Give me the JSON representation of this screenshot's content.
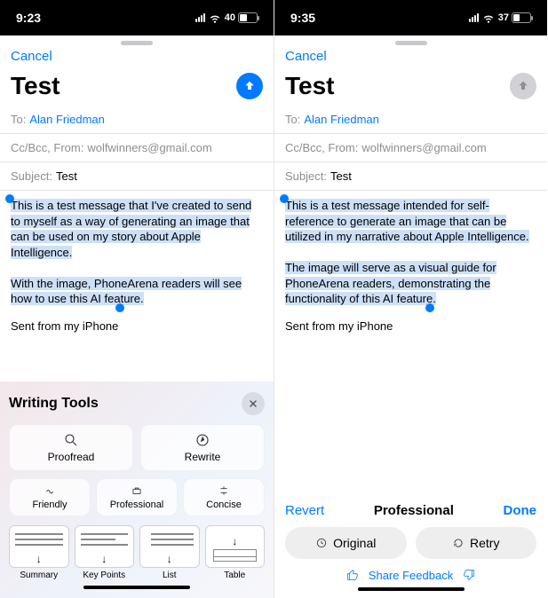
{
  "left": {
    "status": {
      "time": "9:23",
      "battery_pct": 40
    },
    "nav": {
      "cancel": "Cancel"
    },
    "compose": {
      "title": "Test",
      "to_label": "To:",
      "to_name": "Alan Friedman",
      "cc_from_label": "Cc/Bcc, From:",
      "from_email": "wolfwinners@gmail.com",
      "subject_label": "Subject:",
      "subject_value": "Test",
      "paragraph1": "This is a test message that I've created to send to myself as a way of generating an image that can be used on my story about Apple Intelligence.",
      "paragraph2": "With the image, PhoneArena readers will see how to use this AI feature.",
      "signature": "Sent from my iPhone"
    },
    "tools": {
      "title": "Writing Tools",
      "proofread": "Proofread",
      "rewrite": "Rewrite",
      "friendly": "Friendly",
      "professional": "Professional",
      "concise": "Concise",
      "summary": "Summary",
      "keypoints": "Key Points",
      "list": "List",
      "table": "Table"
    }
  },
  "right": {
    "status": {
      "time": "9:35",
      "battery_pct": 37
    },
    "nav": {
      "cancel": "Cancel"
    },
    "compose": {
      "title": "Test",
      "to_label": "To:",
      "to_name": "Alan Friedman",
      "cc_from_label": "Cc/Bcc, From:",
      "from_email": "wolfwinners@gmail.com",
      "subject_label": "Subject:",
      "subject_value": "Test",
      "paragraph1": "This is a test message intended for self-reference to generate an image that can be utilized in my narrative about Apple Intelligence.",
      "paragraph2": "The image will serve as a visual guide for PhoneArena readers, demonstrating the functionality of this AI feature.",
      "signature": "Sent from my iPhone"
    },
    "review": {
      "revert": "Revert",
      "mode": "Professional",
      "done": "Done",
      "original": "Original",
      "retry": "Retry",
      "share": "Share Feedback"
    }
  }
}
